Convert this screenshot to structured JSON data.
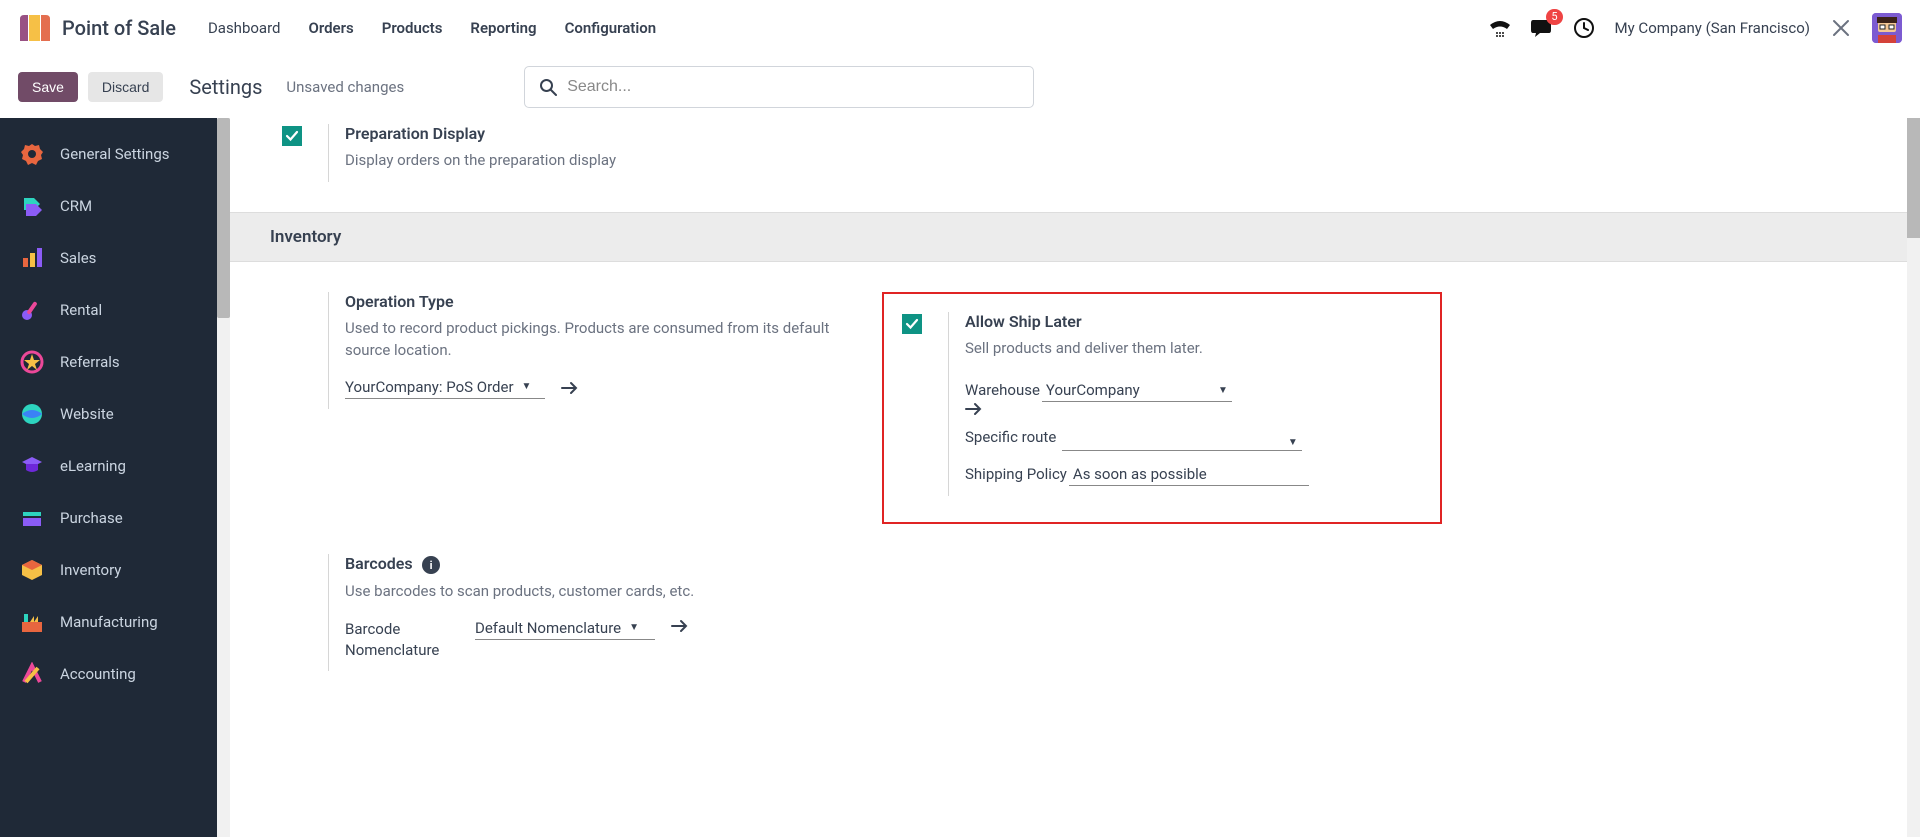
{
  "brand": {
    "title": "Point of Sale"
  },
  "menu": {
    "items": [
      {
        "label": "Dashboard",
        "active": false
      },
      {
        "label": "Orders",
        "active": true
      },
      {
        "label": "Products",
        "active": true
      },
      {
        "label": "Reporting",
        "active": true
      },
      {
        "label": "Configuration",
        "active": true
      }
    ]
  },
  "notifications": {
    "count": "5"
  },
  "company": "My Company (San Francisco)",
  "actions": {
    "save": "Save",
    "discard": "Discard"
  },
  "page": {
    "title": "Settings",
    "status": "Unsaved changes"
  },
  "search": {
    "placeholder": "Search..."
  },
  "sidebar": {
    "items": [
      {
        "label": "General Settings"
      },
      {
        "label": "CRM"
      },
      {
        "label": "Sales"
      },
      {
        "label": "Rental"
      },
      {
        "label": "Referrals"
      },
      {
        "label": "Website"
      },
      {
        "label": "eLearning"
      },
      {
        "label": "Purchase"
      },
      {
        "label": "Inventory"
      },
      {
        "label": "Manufacturing"
      },
      {
        "label": "Accounting"
      }
    ]
  },
  "settings": {
    "prep_display": {
      "title": "Preparation Display",
      "sub": "Display orders on the preparation display",
      "checked": true
    },
    "inventory": {
      "header": "Inventory",
      "operation_type": {
        "title": "Operation Type",
        "sub": "Used to record product pickings. Products are consumed from its default source location.",
        "value": "YourCompany: PoS Order"
      },
      "ship_later": {
        "title": "Allow Ship Later",
        "sub": "Sell products and deliver them later.",
        "checked": true,
        "warehouse_label": "Warehouse",
        "warehouse_value": "YourCompany",
        "route_label": "Specific route",
        "route_value": "",
        "policy_label": "Shipping Policy",
        "policy_value": "As soon as possible"
      },
      "barcodes": {
        "title": "Barcodes",
        "sub": "Use barcodes to scan products, customer cards, etc.",
        "field_label": "Barcode Nomenclature",
        "value": "Default Nomenclature"
      }
    }
  }
}
